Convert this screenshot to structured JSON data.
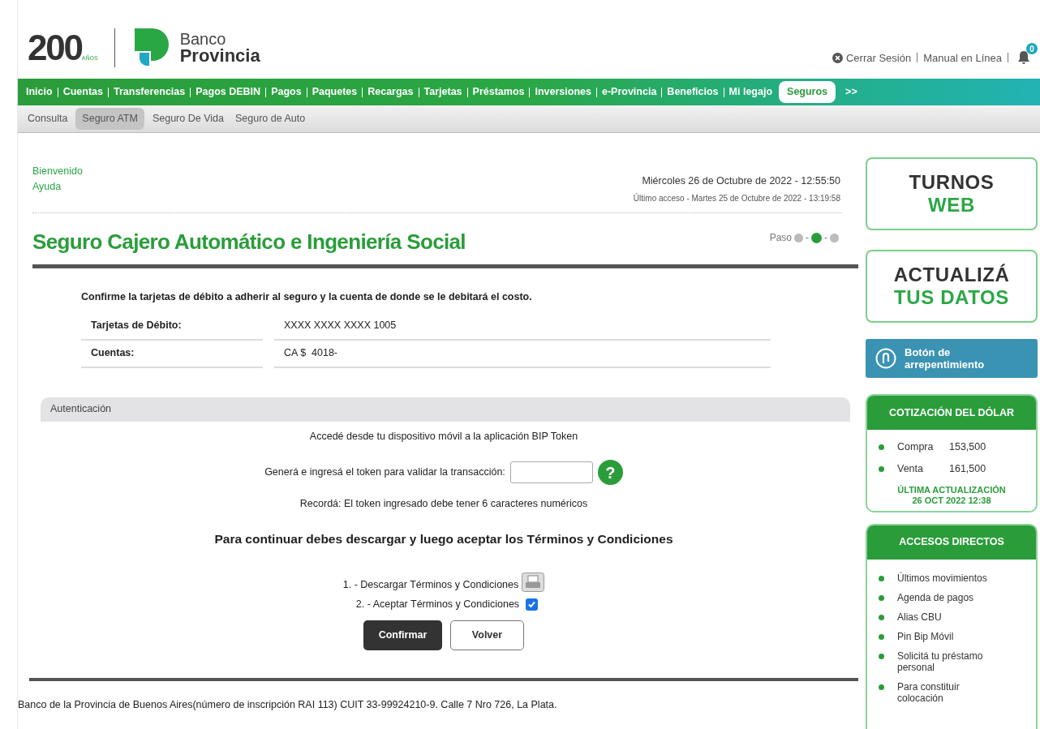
{
  "logo": {
    "anniversary": "200",
    "anniversary_sub": "AÑOS",
    "bank_line1": "Banco",
    "bank_line2": "Provincia"
  },
  "top_links": [
    {
      "label": "Cerrar Sesión",
      "kind": "logout"
    },
    {
      "label": "Manual en Línea",
      "kind": "link"
    }
  ],
  "notifications": {
    "count": "0"
  },
  "nav": [
    {
      "label": "Inicio",
      "selected": false
    },
    {
      "label": "Cuentas",
      "selected": false
    },
    {
      "label": "Transferencias",
      "selected": false
    },
    {
      "label": "Pagos DEBIN",
      "selected": false
    },
    {
      "label": "Pagos",
      "selected": false
    },
    {
      "label": "Paquetes",
      "selected": false
    },
    {
      "label": "Recargas",
      "selected": false
    },
    {
      "label": "Tarjetas",
      "selected": false
    },
    {
      "label": "Préstamos",
      "selected": false
    },
    {
      "label": "Inversiones",
      "selected": false
    },
    {
      "label": "e-Provincia",
      "selected": false
    },
    {
      "label": "Beneficios",
      "selected": false
    },
    {
      "label": "Mi legajo",
      "selected": false
    },
    {
      "label": "Seguros",
      "selected": true
    }
  ],
  "nav_more": ">>",
  "subnav": [
    {
      "label": "Consulta",
      "selected": false
    },
    {
      "label": "Seguro ATM",
      "selected": true
    },
    {
      "label": "Seguro De Vida",
      "selected": false
    },
    {
      "label": "Seguro de Auto",
      "selected": false
    }
  ],
  "welcome": "Bienvenido",
  "help": "Ayuda",
  "datetime": "Miércoles 26 de Octubre de 2022 - 12:55:50",
  "last_access": "Último acceso - Martes 25 de Octubre de 2022 - 13:19:58",
  "title": "Seguro Cajero Automático e Ingeniería Social",
  "steps": {
    "label": "Paso",
    "separator": "-",
    "items": [
      {
        "selected": false
      },
      {
        "selected": true
      },
      {
        "selected": false
      }
    ]
  },
  "instructions": "Confirme la tarjetas de débito a adherir al seguro y la cuenta de donde se le debitará el costo.",
  "details": [
    {
      "label": "Tarjetas de Débito:",
      "value": "XXXX XXXX XXXX 1005"
    },
    {
      "label": "Cuentas:",
      "value": "CA $  4018-"
    }
  ],
  "auth": {
    "header": "Autenticación",
    "line1": "Accedé desde tu dispositivo móvil a la aplicación BIP Token",
    "token_label": "Generá e ingresá el token para validar la transacción:",
    "help_glyph": "?",
    "reminder": "Recordá: El token ingresado debe tener 6 caracteres numéricos"
  },
  "terms": {
    "heading": "Para continuar debes descargar y luego aceptar los Términos y Condiciones",
    "download": "1. - Descargar Términos y Condiciones",
    "accept": "2. - Aceptar Términos y Condiciones",
    "accepted": true
  },
  "buttons": [
    {
      "label": "Confirmar",
      "kind": "primary"
    },
    {
      "label": "Volver",
      "kind": "secondary"
    }
  ],
  "footer": "Banco de la Provincia de Buenos Aires(número de inscripción RAI 113) CUIT 33-99924210-9. Calle 7 Nro 726, La Plata.",
  "promos": [
    {
      "line1": "TURNOS",
      "line2": "WEB"
    },
    {
      "line1": "ACTUALIZÁ",
      "line2": "TUS DATOS"
    }
  ],
  "regret_button": {
    "line1": "Botón de",
    "line2": "arrepentimiento"
  },
  "dollar": {
    "title": "COTIZACIÓN DEL DÓLAR",
    "rates": [
      {
        "label": "Compra",
        "value": "153,500"
      },
      {
        "label": "Venta",
        "value": "161,500"
      }
    ],
    "updated_label": "ÚLTIMA ACTUALIZACIÓN",
    "updated": "26 OCT 2022 12:38"
  },
  "shortcuts": {
    "title": "ACCESOS DIRECTOS",
    "items": [
      "Últimos movimientos",
      "Agenda de pagos",
      "Alias CBU",
      "Pin Bip Móvil",
      "Solicitá tu préstamo personal",
      "Para constituir colocación"
    ]
  }
}
